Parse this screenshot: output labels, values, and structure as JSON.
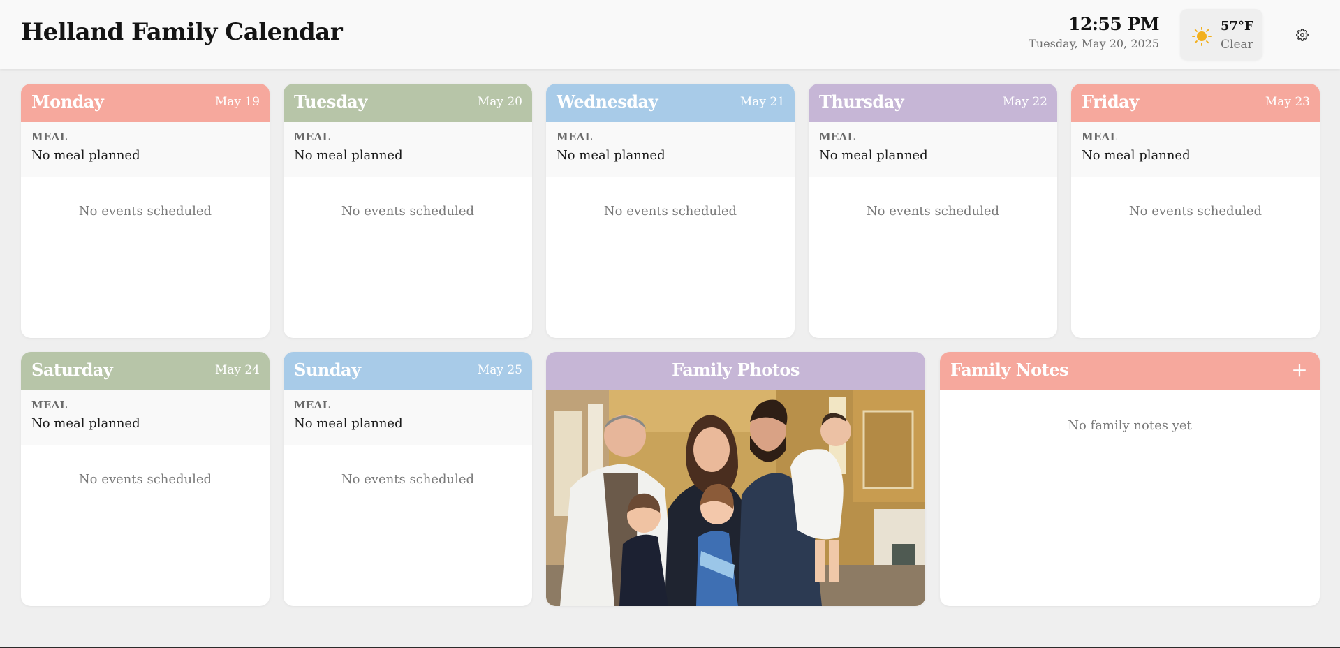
{
  "app": {
    "title": "Helland Family Calendar"
  },
  "header": {
    "time": "12:55 PM",
    "date": "Tuesday, May 20, 2025",
    "weather": {
      "temperature": "57°F",
      "condition": "Clear",
      "icon": "sun-icon"
    },
    "settings_icon": "gear-icon"
  },
  "colors": {
    "coral": "#f6a89d",
    "sage": "#b7c5a8",
    "sky": "#a8cbe8",
    "lavender": "#c6b6d6"
  },
  "days": [
    {
      "name": "Monday",
      "date": "May 19",
      "meal_label": "MEAL",
      "meal": "No meal planned",
      "events": "No events scheduled"
    },
    {
      "name": "Tuesday",
      "date": "May 20",
      "meal_label": "MEAL",
      "meal": "No meal planned",
      "events": "No events scheduled"
    },
    {
      "name": "Wednesday",
      "date": "May 21",
      "meal_label": "MEAL",
      "meal": "No meal planned",
      "events": "No events scheduled"
    },
    {
      "name": "Thursday",
      "date": "May 22",
      "meal_label": "MEAL",
      "meal": "No meal planned",
      "events": "No events scheduled"
    },
    {
      "name": "Friday",
      "date": "May 23",
      "meal_label": "MEAL",
      "meal": "No meal planned",
      "events": "No events scheduled"
    },
    {
      "name": "Saturday",
      "date": "May 24",
      "meal_label": "MEAL",
      "meal": "No meal planned",
      "events": "No events scheduled"
    },
    {
      "name": "Sunday",
      "date": "May 25",
      "meal_label": "MEAL",
      "meal": "No meal planned",
      "events": "No events scheduled"
    }
  ],
  "photos": {
    "title": "Family Photos"
  },
  "notes": {
    "title": "Family Notes",
    "add_label": "+",
    "empty": "No family notes yet"
  }
}
